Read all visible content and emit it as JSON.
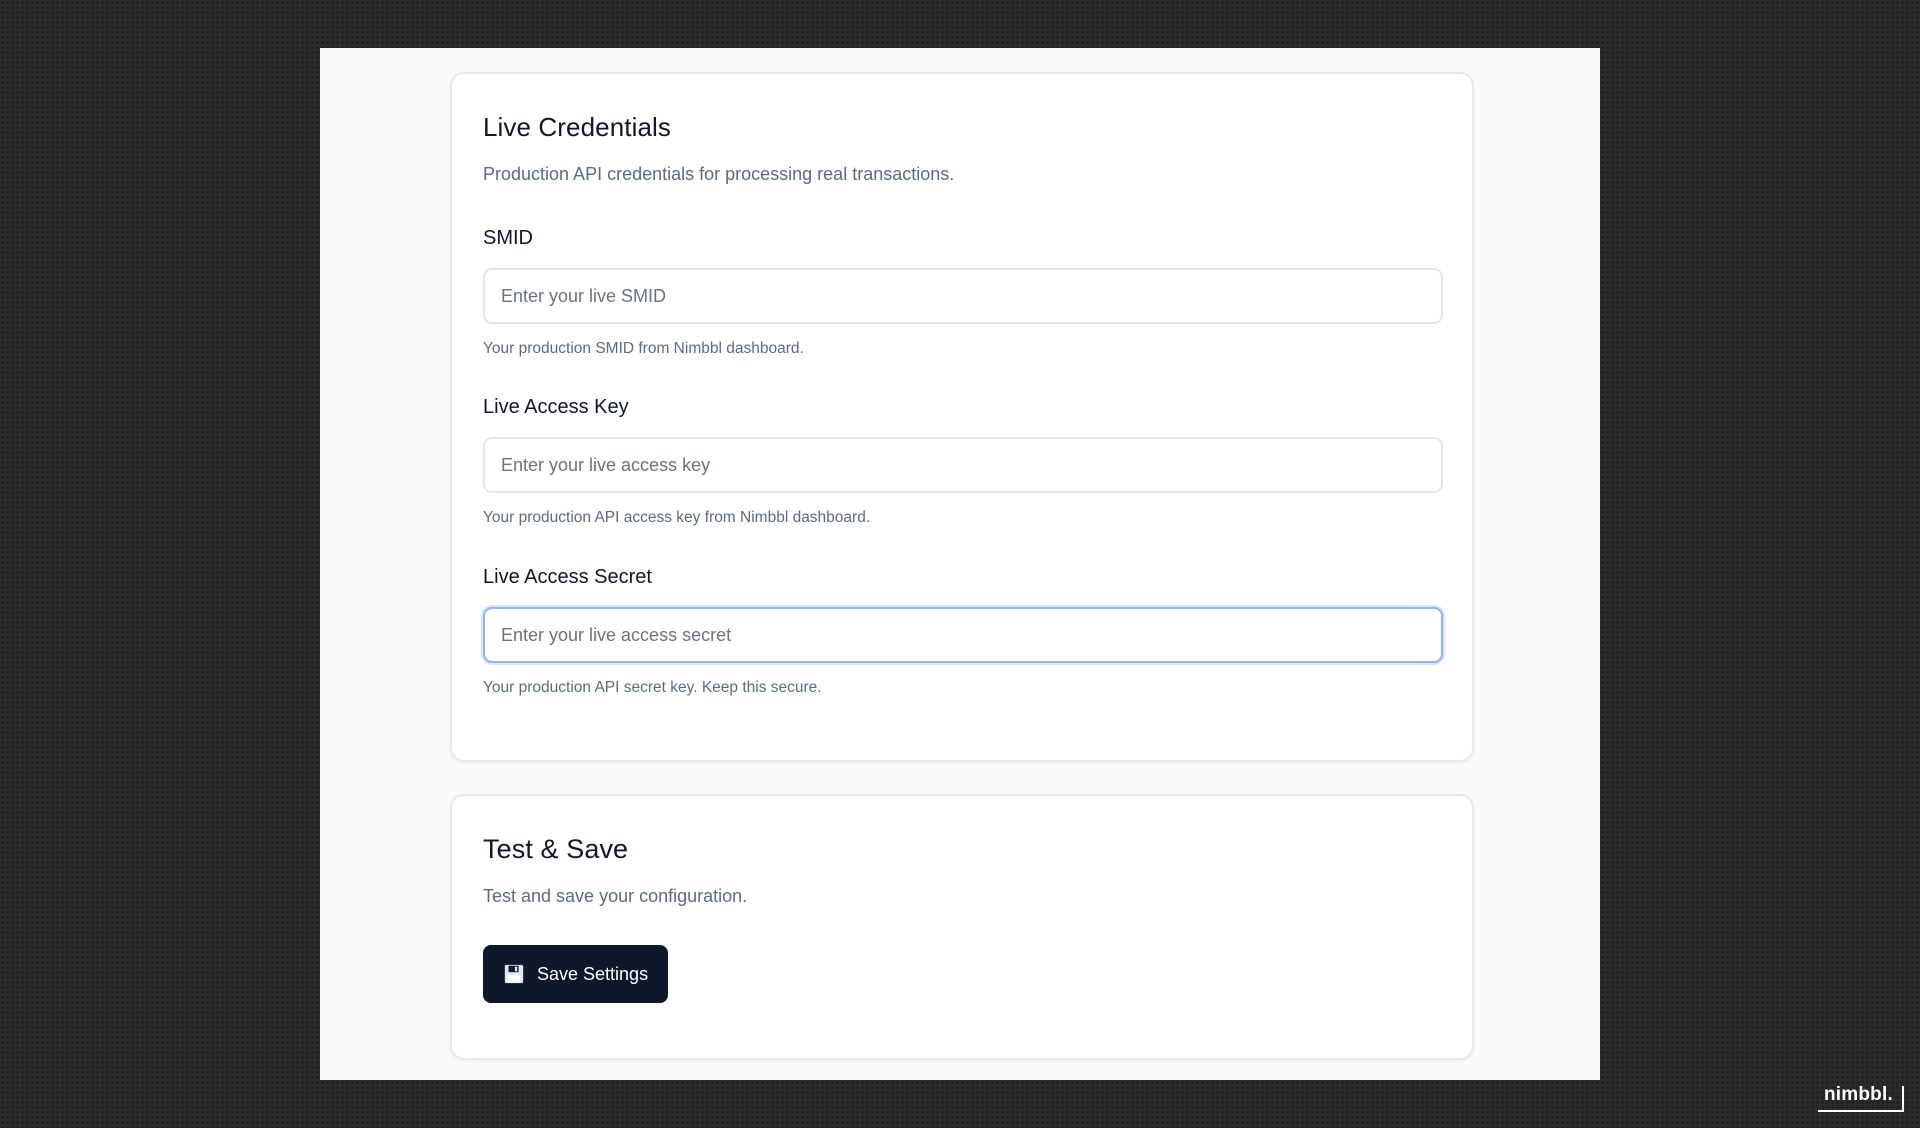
{
  "live_credentials": {
    "title": "Live Credentials",
    "description": "Production API credentials for processing real transactions.",
    "fields": [
      {
        "label": "SMID",
        "value": "",
        "placeholder": "Enter your live SMID",
        "hint": "Your production SMID from Nimbbl dashboard.",
        "focused": false
      },
      {
        "label": "Live Access Key",
        "value": "",
        "placeholder": "Enter your live access key",
        "hint": "Your production API access key from Nimbbl dashboard.",
        "focused": false
      },
      {
        "label": "Live Access Secret",
        "value": "",
        "placeholder": "Enter your live access secret",
        "hint": "Your production API secret key. Keep this secure.",
        "focused": true
      }
    ]
  },
  "test_save": {
    "title": "Test & Save",
    "description": "Test and save your configuration.",
    "save_button": {
      "label": "Save Settings",
      "icon": "floppy-disk-icon"
    }
  },
  "brand": {
    "name": "nimbbl."
  },
  "colors": {
    "primary_button": "#0f172a",
    "focus_ring": "#93b4f0",
    "muted_text": "#5b6b82",
    "card_border": "#e6e8ec",
    "page_background": "#f8fafc"
  }
}
